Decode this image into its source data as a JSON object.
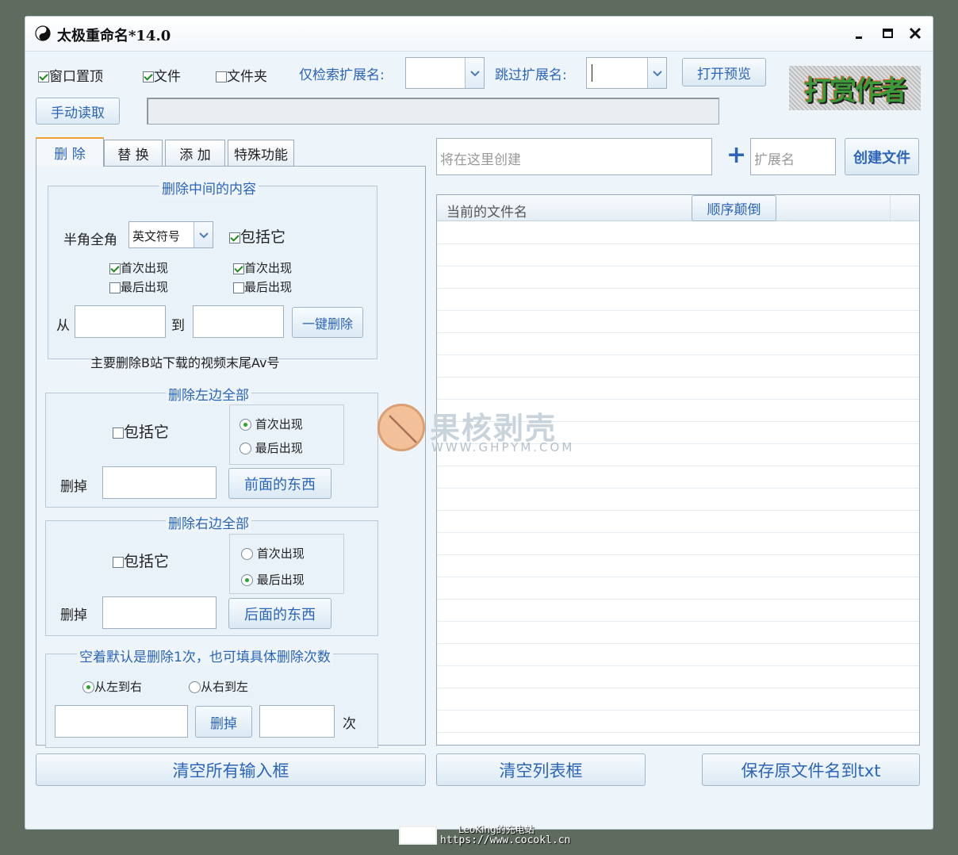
{
  "window": {
    "title": "太极重命名*14.0"
  },
  "toolbar": {
    "topmost": {
      "label": "窗口置顶",
      "checked": true
    },
    "files": {
      "label": "文件",
      "checked": true
    },
    "folders": {
      "label": "文件夹",
      "checked": false
    },
    "only_ext_label": "仅检索扩展名:",
    "skip_ext_label": "跳过扩展名:",
    "open_preview": "打开预览",
    "manual_read": "手动读取",
    "reward_author": "打赏作者"
  },
  "tabs": [
    "删 除",
    "替 换",
    "添 加",
    "特殊功能"
  ],
  "delete_middle": {
    "title": "删除中间的内容",
    "width_label": "半角全角",
    "width_value": "英文符号",
    "include": {
      "label": "包括它",
      "checked": true
    },
    "left_first": {
      "label": "首次出现",
      "checked": true
    },
    "left_last": {
      "label": "最后出现",
      "checked": false
    },
    "right_first": {
      "label": "首次出现",
      "checked": true
    },
    "right_last": {
      "label": "最后出现",
      "checked": false
    },
    "from_label": "从",
    "to_label": "到",
    "one_click": "一键删除",
    "hint": "主要删除B站下载的视频末尾Av号"
  },
  "delete_left": {
    "title": "删除左边全部",
    "include": "包括它",
    "first": "首次出现",
    "last": "最后出现",
    "selected": "first",
    "remove_label": "删掉",
    "action": "前面的东西"
  },
  "delete_right": {
    "title": "删除右边全部",
    "include": "包括它",
    "first": "首次出现",
    "last": "最后出现",
    "selected": "last",
    "remove_label": "删掉",
    "action": "后面的东西"
  },
  "delete_count": {
    "title": "空着默认是删除1次，也可填具体删除次数",
    "ltr": "从左到右",
    "rtl": "从右到左",
    "selected": "ltr",
    "remove_btn": "删掉",
    "times_label": "次"
  },
  "create": {
    "placeholder": "将在这里创建",
    "plus": "+",
    "ext_placeholder": "扩展名",
    "button": "创建文件"
  },
  "list": {
    "header": "当前的文件名",
    "reverse": "顺序颠倒"
  },
  "bottom": {
    "clear_inputs": "清空所有输入框",
    "clear_list": "清空列表框",
    "save_txt": "保存原文件名到txt"
  },
  "watermark": {
    "name": "果核剥壳",
    "url": "WWW.GHPYM.COM"
  },
  "footer": {
    "line1": "LeoKing的充电站",
    "line2": "https://www.cocokl.cn"
  },
  "colors": {
    "accent": "#2c64b8",
    "window_bg": "#edf5fb"
  }
}
